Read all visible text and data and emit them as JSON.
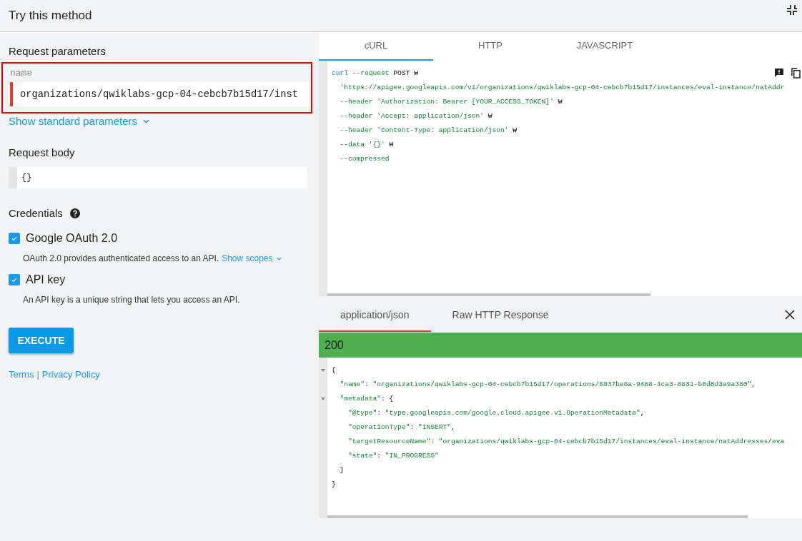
{
  "header": {
    "title": "Try this method"
  },
  "request_parameters": {
    "heading": "Request parameters",
    "field": {
      "label": "name",
      "value": "organizations/qwiklabs-gcp-04-cebcb7b15d17/inst"
    },
    "show_standard": "Show standard parameters"
  },
  "request_body": {
    "heading": "Request body",
    "value": "{}"
  },
  "credentials": {
    "heading": "Credentials",
    "items": [
      {
        "label": "Google OAuth 2.0",
        "checked": true,
        "description": "OAuth 2.0 provides authenticated access to an API.",
        "link": "Show scopes"
      },
      {
        "label": "API key",
        "checked": true,
        "description": "An API key is a unique string that lets you access an API."
      }
    ]
  },
  "execute_button": "EXECUTE",
  "footer_links": [
    "Terms",
    "Privacy Policy"
  ],
  "footer_separator": "|",
  "code_tabs": [
    {
      "label": "cURL",
      "selected": true
    },
    {
      "label": "HTTP",
      "selected": false
    },
    {
      "label": "JAVASCRIPT",
      "selected": false
    }
  ],
  "code_lines": [
    [
      {
        "text": "curl",
        "kind": "keyword"
      },
      {
        "text": " --request",
        "kind": "string"
      },
      {
        "text": " POST ₩",
        "kind": "plain"
      }
    ],
    [
      {
        "text": "  'https://apigee.googleapis.com/v1/organizations/qwiklabs-gcp-04-cebcb7b15d17/instances/eval-instance/natAddr",
        "kind": "string"
      }
    ],
    [
      {
        "text": "  --header 'Authorization: Bearer [YOUR_ACCESS_TOKEN]'",
        "kind": "string"
      },
      {
        "text": " ₩",
        "kind": "plain"
      }
    ],
    [
      {
        "text": "  --header 'Accept: application/json'",
        "kind": "string"
      },
      {
        "text": " ₩",
        "kind": "plain"
      }
    ],
    [
      {
        "text": "  --header 'Content-Type: application/json'",
        "kind": "string"
      },
      {
        "text": " ₩",
        "kind": "plain"
      }
    ],
    [
      {
        "text": "  --data '{}'",
        "kind": "string"
      },
      {
        "text": " ₩",
        "kind": "plain"
      }
    ],
    [
      {
        "text": "  --compressed",
        "kind": "string"
      }
    ]
  ],
  "response_tabs": [
    {
      "label": "application/json",
      "selected": true
    },
    {
      "label": "Raw HTTP Response",
      "selected": false
    }
  ],
  "status": "200",
  "response_lines": [
    {
      "foldable": true,
      "tokens": [
        {
          "text": "{",
          "kind": "plain"
        }
      ]
    },
    {
      "foldable": false,
      "tokens": [
        {
          "text": "  \"name\"",
          "kind": "string"
        },
        {
          "text": ": ",
          "kind": "plain"
        },
        {
          "text": "\"organizations/qwiklabs-gcp-04-cebcb7b15d17/operations/6037be6a-9488-4ca3-8831-b0d8d3a9a380\"",
          "kind": "string"
        },
        {
          "text": ",",
          "kind": "plain"
        }
      ]
    },
    {
      "foldable": true,
      "tokens": [
        {
          "text": "  \"metadata\"",
          "kind": "string"
        },
        {
          "text": ": {",
          "kind": "plain"
        }
      ]
    },
    {
      "foldable": false,
      "tokens": [
        {
          "text": "    \"@type\"",
          "kind": "string"
        },
        {
          "text": ": ",
          "kind": "plain"
        },
        {
          "text": "\"type.googleapis.com/google.cloud.apigee.v1.OperationMetadata\"",
          "kind": "string"
        },
        {
          "text": ",",
          "kind": "plain"
        }
      ]
    },
    {
      "foldable": false,
      "tokens": [
        {
          "text": "    \"operationType\"",
          "kind": "string"
        },
        {
          "text": ": ",
          "kind": "plain"
        },
        {
          "text": "\"INSERT\"",
          "kind": "string"
        },
        {
          "text": ",",
          "kind": "plain"
        }
      ]
    },
    {
      "foldable": false,
      "tokens": [
        {
          "text": "    \"targetResourceName\"",
          "kind": "string"
        },
        {
          "text": ": ",
          "kind": "plain"
        },
        {
          "text": "\"organizations/qwiklabs-gcp-04-cebcb7b15d17/instances/eval-instance/natAddresses/eva",
          "kind": "string"
        }
      ]
    },
    {
      "foldable": false,
      "tokens": [
        {
          "text": "    \"state\"",
          "kind": "string"
        },
        {
          "text": ": ",
          "kind": "plain"
        },
        {
          "text": "\"IN_PROGRESS\"",
          "kind": "string"
        }
      ]
    },
    {
      "foldable": false,
      "tokens": [
        {
          "text": "  }",
          "kind": "plain"
        }
      ]
    },
    {
      "foldable": false,
      "tokens": [
        {
          "text": "}",
          "kind": "plain"
        }
      ]
    }
  ]
}
